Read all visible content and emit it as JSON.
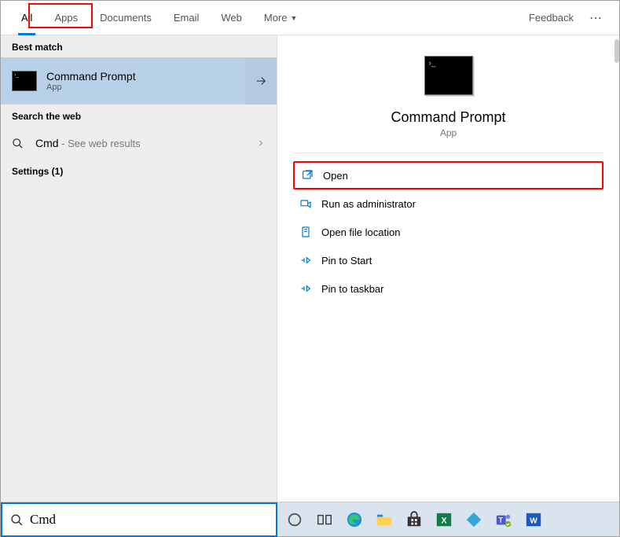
{
  "tabs": [
    "All",
    "Apps",
    "Documents",
    "Email",
    "Web",
    "More"
  ],
  "active_tab": 0,
  "feedback_label": "Feedback",
  "sections": {
    "best_match_header": "Best match",
    "search_web_header": "Search the web",
    "settings_header": "Settings (1)"
  },
  "best_match": {
    "title": "Command Prompt",
    "subtitle": "App"
  },
  "web_result": {
    "query": "Cmd",
    "suffix": " - See web results"
  },
  "preview": {
    "title": "Command Prompt",
    "subtitle": "App"
  },
  "actions": [
    {
      "icon": "open",
      "label": "Open",
      "highlighted": true
    },
    {
      "icon": "admin",
      "label": "Run as administrator",
      "highlighted": false
    },
    {
      "icon": "folder",
      "label": "Open file location",
      "highlighted": false
    },
    {
      "icon": "pin",
      "label": "Pin to Start",
      "highlighted": false
    },
    {
      "icon": "pin",
      "label": "Pin to taskbar",
      "highlighted": false
    }
  ],
  "search": {
    "value": "Cmd"
  },
  "taskbar_icons": [
    "cortana",
    "taskview",
    "edge",
    "explorer",
    "store",
    "excel",
    "kodi",
    "teams",
    "word"
  ]
}
